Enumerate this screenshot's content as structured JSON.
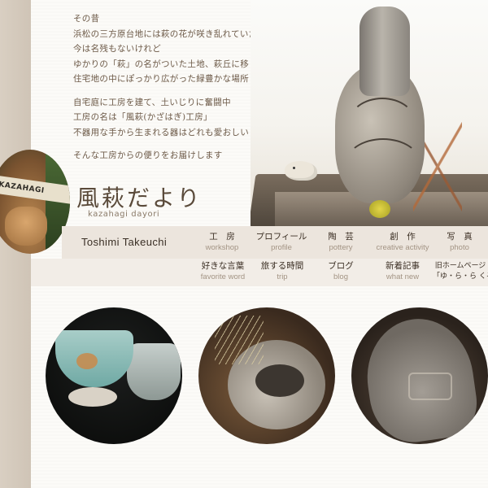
{
  "intro": {
    "lines_a": [
      "その昔",
      "浜松の三方原台地には萩の花が咲き乱れていたという",
      "今は名残もないけれど",
      "ゆかりの「萩」の名がついた土地、萩丘に移り住み",
      "住宅地の中にぽっかり広がった緑豊かな場所"
    ],
    "lines_b": [
      "自宅庭に工房を建て、土いじりに奮闘中",
      "工房の名は「風萩(かざはぎ)工房」",
      "不器用な手から生まれる器はどれも愛おしい"
    ],
    "lines_c": [
      "そんな工房からの便りをお届けします"
    ]
  },
  "logo": {
    "sign_text": "KAZAHAGI"
  },
  "site": {
    "title": "風萩だより",
    "subtitle": "kazahagi dayori"
  },
  "author": "Toshimi Takeuchi",
  "nav_primary": [
    {
      "jp": "工　房",
      "en": "workshop"
    },
    {
      "jp": "プロフィール",
      "en": "profile"
    },
    {
      "jp": "陶　芸",
      "en": "pottery"
    },
    {
      "jp": "創　作",
      "en": "creative activity"
    },
    {
      "jp": "写　真",
      "en": "photo"
    }
  ],
  "nav_secondary": [
    {
      "jp": "好きな言葉",
      "en": "favorite word"
    },
    {
      "jp": "旅する時間",
      "en": "trip"
    },
    {
      "jp": "ブログ",
      "en": "blog"
    },
    {
      "jp": "新着記事",
      "en": "what new"
    },
    {
      "jp": "旧ホームページ",
      "en": "「ゆ・ら・ら くるりん」"
    }
  ],
  "photos": [
    "teacups",
    "pot-with-grass",
    "carved-vase"
  ]
}
